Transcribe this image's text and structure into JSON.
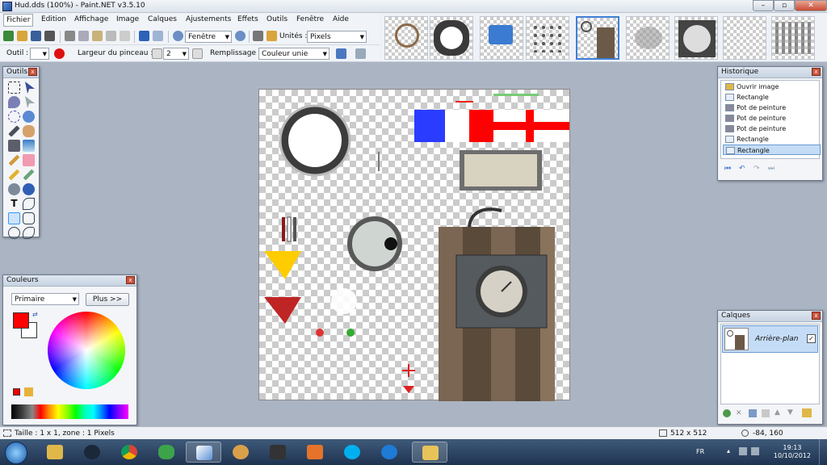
{
  "window": {
    "title": "Hud.dds (100%) - Paint.NET v3.5.10"
  },
  "menu": [
    "Fichier",
    "Edition",
    "Affichage",
    "Image",
    "Calques",
    "Ajustements",
    "Effets",
    "Outils",
    "Fenêtre",
    "Aide"
  ],
  "toolbar1": {
    "zoom_value": "Fenêtre",
    "units_label": "Unités :",
    "units_value": "Pixels"
  },
  "toolbar2": {
    "tool_label": "Outil :",
    "brush_label": "Largeur du pinceau :",
    "brush_value": "2",
    "fill_label": "Remplissage :",
    "fill_value": "Couleur unie"
  },
  "tools_panel": {
    "title": "Outils"
  },
  "colors_panel": {
    "title": "Couleurs",
    "mode": "Primaire",
    "more_button": "Plus >>",
    "primary_color": "#ff0000",
    "secondary_color": "#ffffff"
  },
  "history_panel": {
    "title": "Historique",
    "items": [
      "Ouvrir image",
      "Rectangle",
      "Pot de peinture",
      "Pot de peinture",
      "Pot de peinture",
      "Rectangle",
      "Rectangle"
    ]
  },
  "layers_panel": {
    "title": "Calques",
    "layer_name": "Arrière-plan"
  },
  "status": {
    "selection_info": "Taille : 1 x 1, zone : 1 Pixels",
    "image_size": "512 x 512",
    "cursor_pos": "-84, 160"
  },
  "taskbar": {
    "language": "FR",
    "time": "19:13",
    "date": "10/10/2012"
  },
  "colors": {
    "accent": "#3f7fd6",
    "workspace": "#abb4c3"
  }
}
